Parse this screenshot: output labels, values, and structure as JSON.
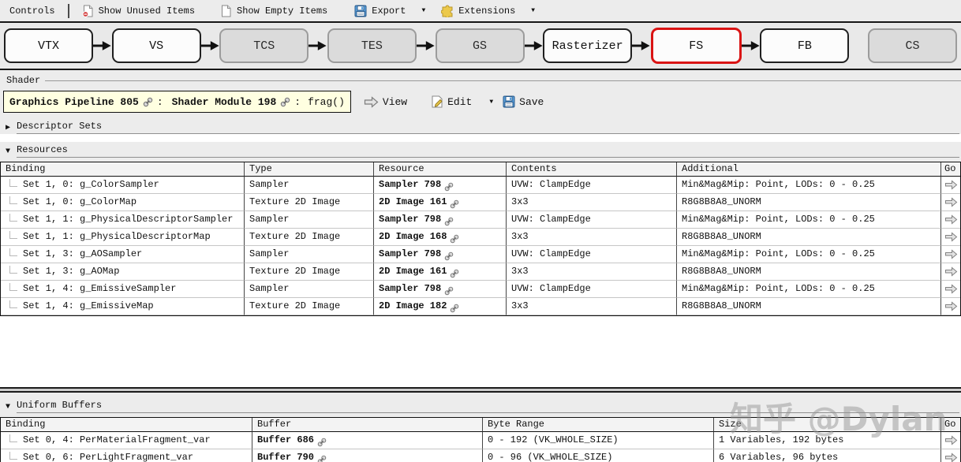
{
  "toolbar": {
    "controls_label": "Controls",
    "show_unused_label": "Show Unused Items",
    "show_empty_label": "Show Empty Items",
    "export_label": "Export",
    "extensions_label": "Extensions",
    "dropdown_glyph": "▼"
  },
  "pipeline": {
    "selected_stage": "FS",
    "stages": [
      {
        "label": "VTX",
        "state": "active",
        "arrow_after": true
      },
      {
        "label": "VS",
        "state": "active",
        "arrow_after": true
      },
      {
        "label": "TCS",
        "state": "inactive",
        "arrow_after": true
      },
      {
        "label": "TES",
        "state": "inactive",
        "arrow_after": true
      },
      {
        "label": "GS",
        "state": "inactive",
        "arrow_after": true
      },
      {
        "label": "Rasterizer",
        "state": "active",
        "arrow_after": true
      },
      {
        "label": "FS",
        "state": "selected",
        "arrow_after": true
      },
      {
        "label": "FB",
        "state": "active",
        "arrow_after": false
      },
      {
        "label": "CS",
        "state": "inactive",
        "arrow_after": false
      }
    ]
  },
  "shader_section": {
    "group_label": "Shader",
    "pipeline_name": "Graphics Pipeline 805",
    "colon1": ":",
    "module_name": "Shader Module 198",
    "colon2": ":",
    "entry_point": "frag()",
    "view_label": "View",
    "edit_label": "Edit",
    "save_label": "Save"
  },
  "sections": {
    "descriptor_sets": {
      "label": "Descriptor Sets",
      "triangle": "▶",
      "expanded": false
    },
    "resources": {
      "label": "Resources",
      "triangle": "▼",
      "expanded": true
    },
    "uniform_buffers": {
      "label": "Uniform Buffers",
      "triangle": "▼",
      "expanded": true
    }
  },
  "resources_table": {
    "columns": [
      "Binding",
      "Type",
      "Resource",
      "Contents",
      "Additional",
      "Go"
    ],
    "rows": [
      {
        "binding": "Set 1, 0: g_ColorSampler",
        "type": "Sampler",
        "resource": "Sampler 798",
        "contents": "UVW: ClampEdge",
        "additional": "Min&Mag&Mip: Point, LODs: 0 - 0.25"
      },
      {
        "binding": "Set 1, 0: g_ColorMap",
        "type": "Texture 2D Image",
        "resource": "2D Image 161",
        "contents": "3x3",
        "additional": "R8G8B8A8_UNORM"
      },
      {
        "binding": "Set 1, 1: g_PhysicalDescriptorSampler",
        "type": "Sampler",
        "resource": "Sampler 798",
        "contents": "UVW: ClampEdge",
        "additional": "Min&Mag&Mip: Point, LODs: 0 - 0.25"
      },
      {
        "binding": "Set 1, 1: g_PhysicalDescriptorMap",
        "type": "Texture 2D Image",
        "resource": "2D Image 168",
        "contents": "3x3",
        "additional": "R8G8B8A8_UNORM"
      },
      {
        "binding": "Set 1, 3: g_AOSampler",
        "type": "Sampler",
        "resource": "Sampler 798",
        "contents": "UVW: ClampEdge",
        "additional": "Min&Mag&Mip: Point, LODs: 0 - 0.25"
      },
      {
        "binding": "Set 1, 3: g_AOMap",
        "type": "Texture 2D Image",
        "resource": "2D Image 161",
        "contents": "3x3",
        "additional": "R8G8B8A8_UNORM"
      },
      {
        "binding": "Set 1, 4: g_EmissiveSampler",
        "type": "Sampler",
        "resource": "Sampler 798",
        "contents": "UVW: ClampEdge",
        "additional": "Min&Mag&Mip: Point, LODs: 0 - 0.25"
      },
      {
        "binding": "Set 1, 4: g_EmissiveMap",
        "type": "Texture 2D Image",
        "resource": "2D Image 182",
        "contents": "3x3",
        "additional": "R8G8B8A8_UNORM"
      }
    ]
  },
  "uniform_buffers_table": {
    "columns": [
      "Binding",
      "Buffer",
      "Byte Range",
      "Size",
      "Go"
    ],
    "rows": [
      {
        "binding": "Set 0, 4: PerMaterialFragment_var",
        "buffer": "Buffer 686",
        "byte_range": "0 - 192 (VK_WHOLE_SIZE)",
        "size": "1 Variables, 192 bytes"
      },
      {
        "binding": "Set 0, 6: PerLightFragment_var",
        "buffer": "Buffer 790",
        "byte_range": "0 - 96 (VK_WHOLE_SIZE)",
        "size": "6 Variables, 96 bytes"
      }
    ]
  },
  "watermark": "知乎 @Dylan",
  "colors": {
    "selected_stage_border": "#da1414",
    "export_icon_blue": "#5aa0dc",
    "extensions_icon_yellow": "#ecc94b",
    "unused_badge_red": "#d23c3c",
    "shader_box_bg": "#ffffe1"
  }
}
